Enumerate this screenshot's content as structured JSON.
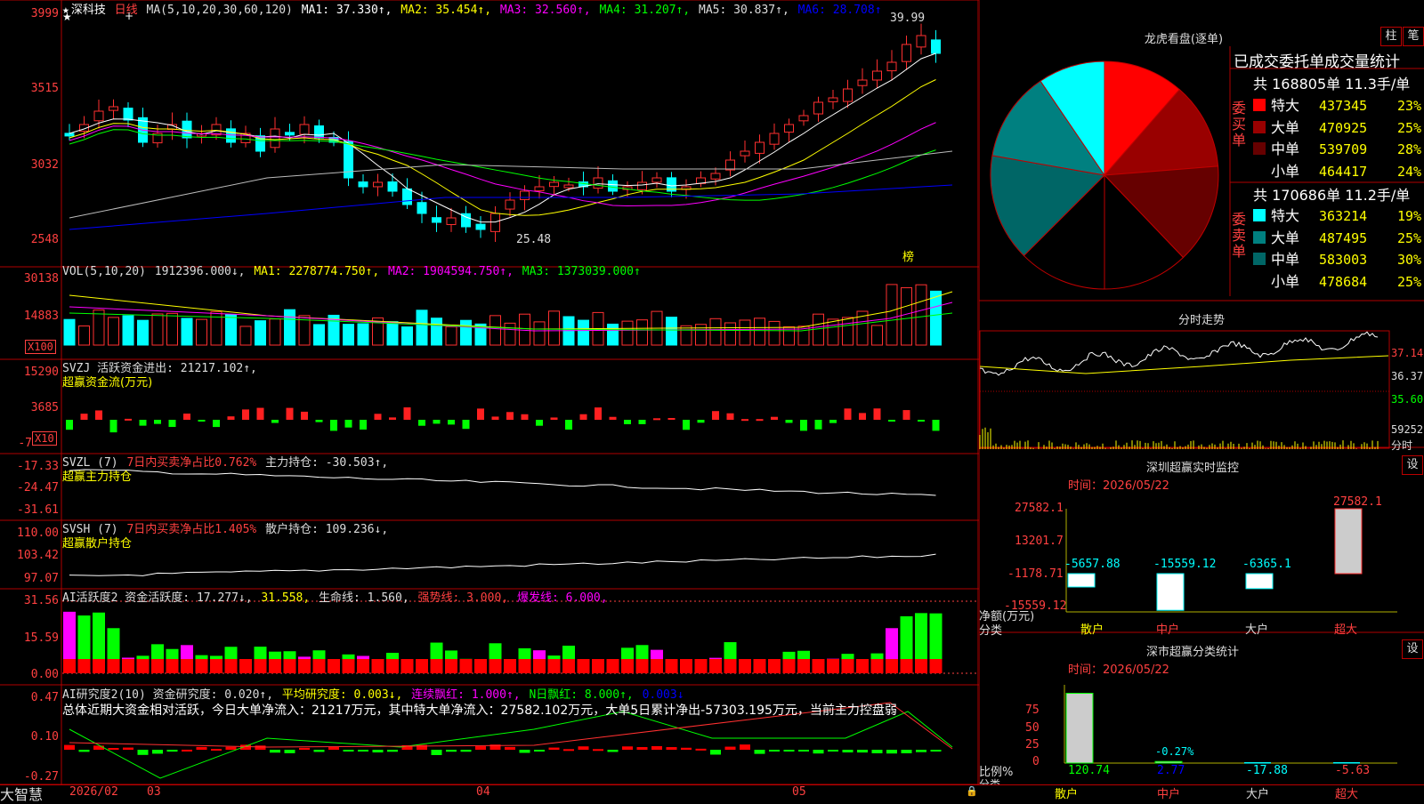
{
  "stock": {
    "name": "深科技",
    "period": "日线"
  },
  "kline": {
    "ma_legend": [
      {
        "text": "MA(5,10,20,30,60,120)",
        "color": "#dddddd"
      },
      {
        "text": "MA1: 37.330↑,",
        "color": "#ffffff"
      },
      {
        "text": "MA2: 35.454↑,",
        "color": "#ffff00"
      },
      {
        "text": "MA3: 32.560↑,",
        "color": "#ff00ff"
      },
      {
        "text": "MA4: 31.207↑,",
        "color": "#00ff00"
      },
      {
        "text": "MA5: 30.837↑,",
        "color": "#dddddd"
      },
      {
        "text": "MA6: 28.708↑",
        "color": "#0000ff"
      }
    ],
    "y_labels": [
      "3999",
      "3515",
      "3032",
      "2548"
    ],
    "high_label": "39.99",
    "low_label": "25.48",
    "badge": "榜"
  },
  "vol": {
    "legend": [
      {
        "text": "VOL(5,10,20)",
        "color": "#dddddd"
      },
      {
        "text": "1912396.000↓,",
        "color": "#dddddd"
      },
      {
        "text": "MA1: 2278774.750↑,",
        "color": "#ffff00"
      },
      {
        "text": "MA2: 1904594.750↑,",
        "color": "#ff00ff"
      },
      {
        "text": "MA3: 1373039.000↑",
        "color": "#00ff00"
      }
    ],
    "y_labels": [
      "30138",
      "14883"
    ],
    "unit": "X100"
  },
  "svzj": {
    "legend": [
      {
        "text": "SVZJ  活跃资金进出: 21217.102↑,",
        "color": "#dddddd"
      }
    ],
    "subtitle": "超赢资金流(万元)",
    "y_labels": [
      "15290",
      "3685",
      "-7"
    ],
    "unit": "X10"
  },
  "svzl": {
    "legend": [
      {
        "text": "SVZL (7)",
        "color": "#dddddd"
      },
      {
        "text": "7日内买卖净占比0.762%",
        "color": "#ff4040"
      },
      {
        "text": "主力持仓: -30.503↑,",
        "color": "#dddddd"
      }
    ],
    "subtitle": "超赢主力持仓",
    "y_labels": [
      "-17.33",
      "-24.47",
      "-31.61"
    ]
  },
  "svsh": {
    "legend": [
      {
        "text": "SVSH (7)",
        "color": "#dddddd"
      },
      {
        "text": "7日内买卖净占比1.405%",
        "color": "#ff4040"
      },
      {
        "text": "散户持仓: 109.236↓,",
        "color": "#dddddd"
      }
    ],
    "subtitle": "超赢散户持仓",
    "y_labels": [
      "110.00",
      "103.42",
      "97.07"
    ]
  },
  "ai_active": {
    "legend": [
      {
        "text": "AI活跃度2 资金活跃度: 17.277↓,",
        "color": "#dddddd"
      },
      {
        "text": "31.558,",
        "color": "#ffff00"
      },
      {
        "text": "生命线: 1.560,",
        "color": "#dddddd"
      },
      {
        "text": "强势线: 3.000,",
        "color": "#ff4040"
      },
      {
        "text": "爆发线: 6.000,",
        "color": "#ff00ff"
      }
    ],
    "y_labels": [
      "31.56",
      "15.59",
      "0.00"
    ]
  },
  "ai_research": {
    "legend": [
      {
        "text": "AI研究度2(10) 资金研究度: 0.020↑,",
        "color": "#dddddd"
      },
      {
        "text": "平均研究度: 0.003↓,",
        "color": "#ffff00"
      },
      {
        "text": "连续飘红: 1.000↑,",
        "color": "#ff00ff"
      },
      {
        "text": "N日飘红: 8.000↑,",
        "color": "#00ff00"
      },
      {
        "text": "0.003↓",
        "color": "#0000ff"
      }
    ],
    "summary": "总体近期大资金相对活跃，今日大单净流入：21217万元，其中特大单净流入：27582.102万元，大单5日累计净出-57303.195万元，当前主力控盘弱",
    "y_labels": [
      "0.47",
      "0.10",
      "-0.27"
    ]
  },
  "time_axis": [
    "2026/02",
    "03",
    "04",
    "05"
  ],
  "app_logo": "大智慧",
  "lhb": {
    "title": "龙虎看盘(逐单)",
    "btn1": "柱",
    "btn2": "笔",
    "table_title": "已成交委托单成交量统计",
    "buy": {
      "summary": "共 168805单 11.3手/单",
      "side_label": "委买单",
      "rows": [
        {
          "label": "特大",
          "value": "437345",
          "pct": "23%",
          "color": "#ff0000"
        },
        {
          "label": "大单",
          "value": "470925",
          "pct": "25%",
          "color": "#990000"
        },
        {
          "label": "中单",
          "value": "539709",
          "pct": "28%",
          "color": "#660000"
        },
        {
          "label": "小单",
          "value": "464417",
          "pct": "24%",
          "color": "#000000"
        }
      ]
    },
    "sell": {
      "summary": "共 170686单 11.2手/单",
      "side_label": "委卖单",
      "rows": [
        {
          "label": "特大",
          "value": "363214",
          "pct": "19%",
          "color": "#00ffff"
        },
        {
          "label": "大单",
          "value": "487495",
          "pct": "25%",
          "color": "#008080"
        },
        {
          "label": "中单",
          "value": "583003",
          "pct": "30%",
          "color": "#006666"
        },
        {
          "label": "小单",
          "value": "478684",
          "pct": "25%",
          "color": "#000000"
        }
      ]
    }
  },
  "intraday": {
    "title": "分时走势",
    "price_labels": [
      "37.14",
      "36.37",
      "35.60"
    ],
    "vol_label": "59252",
    "vol_unit": "分时"
  },
  "sz_monitor": {
    "title": "深圳超赢实时监控",
    "btn": "设",
    "date": "时间：2026/05/22",
    "y_labels": [
      "27582.1",
      "13201.7",
      "-1178.71",
      "-15559.12"
    ],
    "y_title": "净额(万元)",
    "x_title": "分类",
    "categories": [
      "散户",
      "中户",
      "大户",
      "超大"
    ],
    "values": [
      "-5657.88",
      "-15559.12",
      "-6365.1",
      "27582.1"
    ]
  },
  "sz_stats": {
    "title": "深市超赢分类统计",
    "btn": "设",
    "date": "时间：2026/05/22",
    "y_labels": [
      "75",
      "50",
      "25",
      "0"
    ],
    "y_title": "比例%",
    "x_title": "分类",
    "categories": [
      "散户",
      "中户",
      "大户",
      "超大"
    ],
    "values": [
      "120.74",
      "2.77",
      "-17.88",
      "-5.63"
    ],
    "bar_note": "-0.27%"
  }
}
